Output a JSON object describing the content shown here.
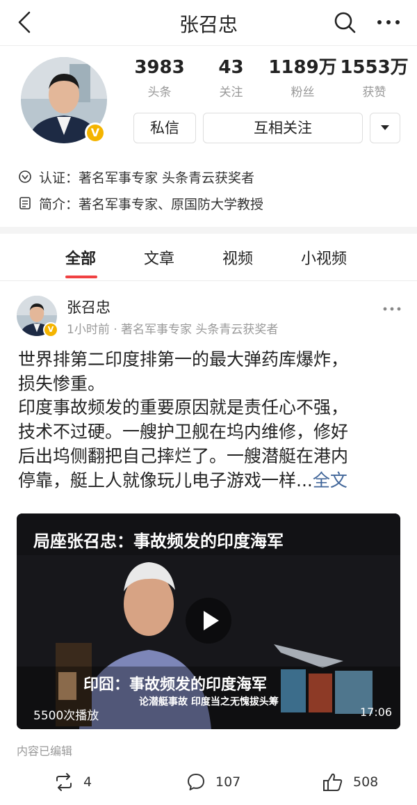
{
  "header": {
    "title": "张召忠"
  },
  "profile": {
    "stats": [
      {
        "value": "3983",
        "label": "头条"
      },
      {
        "value": "43",
        "label": "关注"
      },
      {
        "value": "1189万",
        "label": "粉丝"
      },
      {
        "value": "1553万",
        "label": "获赞"
      }
    ],
    "message_label": "私信",
    "follow_label": "互相关注",
    "certification": "认证：著名军事专家 头条青云获奖者",
    "intro": "简介：著名军事专家、原国防大学教授"
  },
  "tabs": [
    "全部",
    "文章",
    "视频",
    "小视频"
  ],
  "post": {
    "author": "张召忠",
    "meta": "1小时前 · 著名军事专家 头条青云获奖者",
    "text_line1": "世界排第二印度排第一的最大弹药库爆炸，",
    "text_line2": "损失惨重。",
    "text_line3": "印度事故频发的重要原因就是责任心不强，",
    "text_line4": "技术不过硬。一艘护卫舰在坞内维修，修好",
    "text_line5": "后出坞侧翻把自己摔烂了。一艘潜艇在港内",
    "text_line6": "停靠，艇上人就像玩儿电子游戏一样...",
    "full_text_link": "全文",
    "video": {
      "title": "局座张召忠：事故频发的印度海军",
      "caption": "印囧：事故频发的印度海军",
      "subcaption": "论潜艇事故  印度当之无愧拔头筹",
      "views": "5500次播放",
      "duration": "17:06"
    },
    "edited_note": "内容已编辑",
    "share_count": "4",
    "comment_count": "107",
    "like_count": "508"
  },
  "colors": {
    "accent": "#f04142",
    "link": "#406599",
    "badge": "#f4b400"
  }
}
